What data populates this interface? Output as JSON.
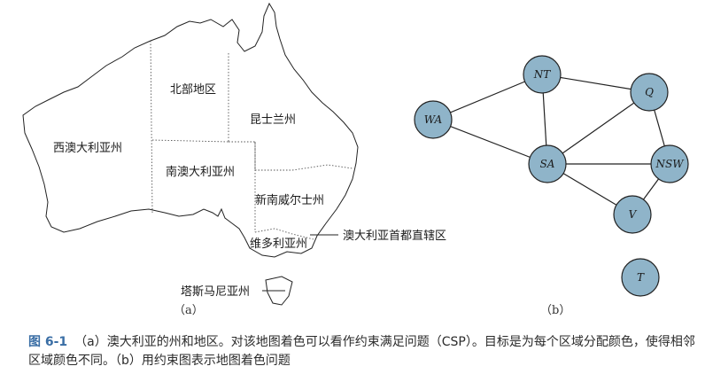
{
  "map": {
    "regions": {
      "western_australia": "西澳大利亚州",
      "northern_territory": "北部地区",
      "queensland": "昆士兰州",
      "south_australia": "南澳大利亚州",
      "new_south_wales": "新南威尔士州",
      "victoria": "维多利亚州",
      "tasmania": "塔斯马尼亚州",
      "act": "澳大利亚首都直辖区"
    },
    "panel_label": "（a）"
  },
  "graph": {
    "nodes": [
      "WA",
      "NT",
      "Q",
      "SA",
      "NSW",
      "V",
      "T"
    ],
    "edges": [
      [
        "WA",
        "NT"
      ],
      [
        "WA",
        "SA"
      ],
      [
        "NT",
        "SA"
      ],
      [
        "NT",
        "Q"
      ],
      [
        "SA",
        "Q"
      ],
      [
        "SA",
        "NSW"
      ],
      [
        "SA",
        "V"
      ],
      [
        "Q",
        "NSW"
      ],
      [
        "NSW",
        "V"
      ]
    ],
    "node_color": "#8fb4c9",
    "panel_label": "（b）"
  },
  "caption": {
    "figure_number": "图 6-1",
    "text": "（a）澳大利亚的州和地区。对该地图着色可以看作约束满足问题（CSP）。目标是为每个区域分配颜色，使得相邻区域颜色不同。（b）用约束图表示地图着色问题"
  }
}
